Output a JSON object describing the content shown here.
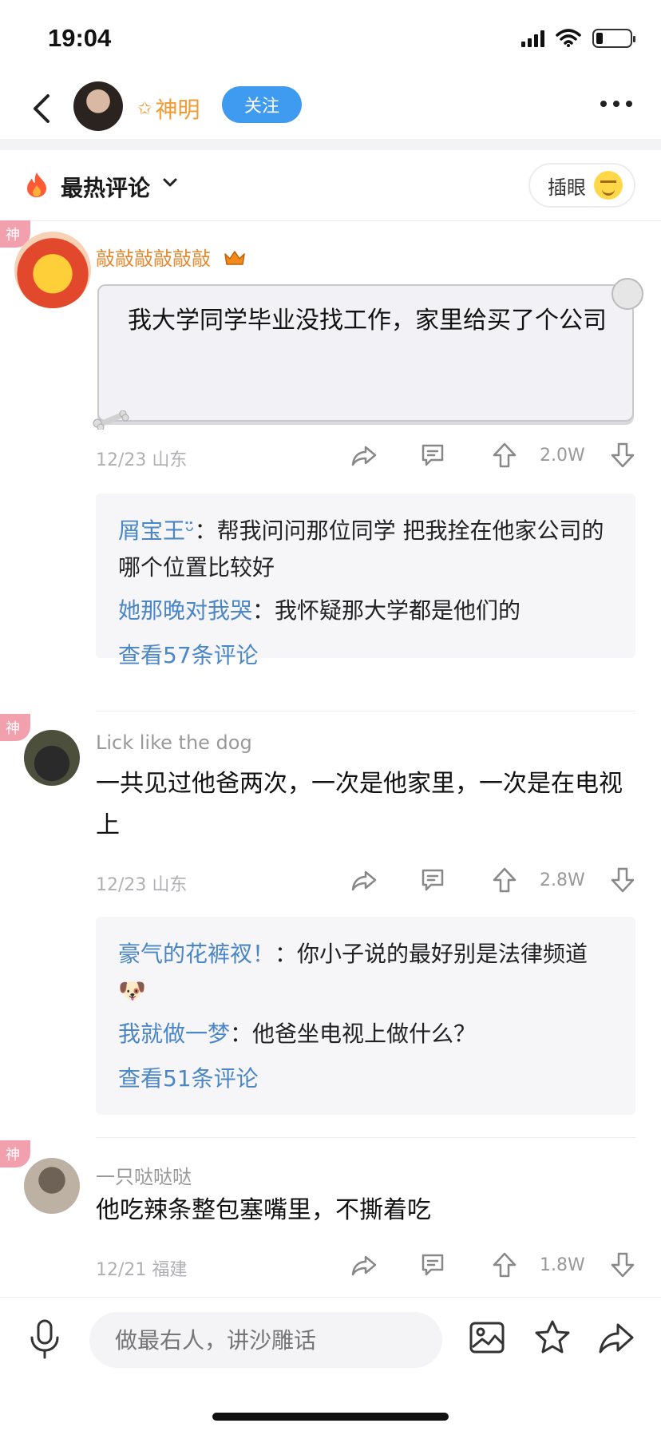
{
  "status_bar": {
    "time": "19:04"
  },
  "header": {
    "username": "神明",
    "follow_label": "关注"
  },
  "section": {
    "title": "最热评论",
    "insert_label": "插眼"
  },
  "comments": [
    {
      "tag": "神",
      "name": "敲敲敲敲敲敲",
      "text": "我大学同学毕业没找工作，家里给买了个公司",
      "meta": "12/23 山东",
      "votes": "2.0W",
      "replies": [
        {
          "name": "屑宝王ᵕ̈",
          "sep": "：",
          "text": "帮我问问那位同学 把我拴在他家公司的哪个位置比较好"
        },
        {
          "name": "她那晚对我哭",
          "sep": "：",
          "text": "我怀疑那大学都是他们的"
        }
      ],
      "view_more": "查看57条评论"
    },
    {
      "tag": "神",
      "name": "Lick like the dog",
      "text": "一共见过他爸两次，一次是他家里，一次是在电视上",
      "meta": "12/23 山东",
      "votes": "2.8W",
      "replies": [
        {
          "name": "豪气的花裤衩！",
          "sep": "：",
          "text": "你小子说的最好别是法律频道🐶"
        },
        {
          "name": "我就做一梦",
          "sep": "：",
          "text": "他爸坐电视上做什么？"
        }
      ],
      "view_more": "查看51条评论"
    },
    {
      "tag": "神",
      "name": "一只哒哒哒",
      "text": "他吃辣条整包塞嘴里，不撕着吃",
      "meta": "12/21 福建",
      "votes": "1.8W"
    }
  ],
  "bottom_bar": {
    "input_placeholder": "做最右人，讲沙雕话"
  }
}
